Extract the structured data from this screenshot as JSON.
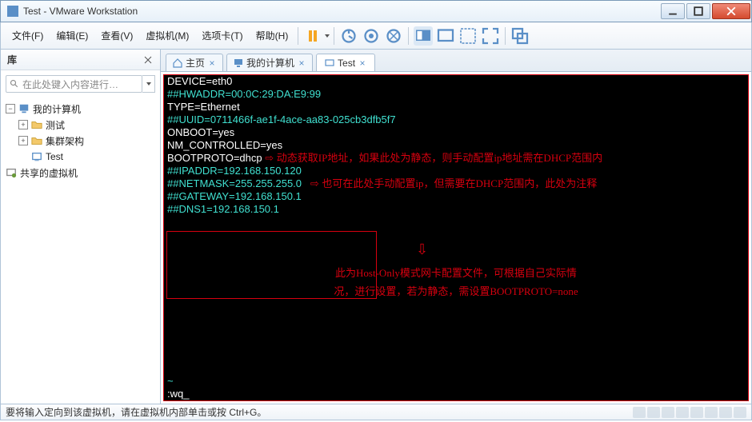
{
  "window": {
    "title": "Test - VMware Workstation"
  },
  "menu": {
    "file": "文件(F)",
    "edit": "编辑(E)",
    "view": "查看(V)",
    "vm": "虚拟机(M)",
    "tabs": "选项卡(T)",
    "help": "帮助(H)"
  },
  "sidebar": {
    "title": "库",
    "search_placeholder": "在此处键入内容进行…",
    "nodes": {
      "root": "我的计算机",
      "n1": "测试",
      "n2": "集群架构",
      "n3": "Test",
      "shared": "共享的虚拟机"
    }
  },
  "tabs": {
    "home": "主页",
    "mycomputer": "我的计算机",
    "test": "Test"
  },
  "console": {
    "l1": "DEVICE=eth0",
    "l2": "##HWADDR=00:0C:29:DA:E9:99",
    "l3": "TYPE=Ethernet",
    "l4": "##UUID=0711466f-ae1f-4ace-aa83-025cb3dfb5f7",
    "l5": "ONBOOT=yes",
    "l6": "NM_CONTROLLED=yes",
    "l7": "BOOTPROTO=dhcp",
    "l8": "##IPADDR=192.168.150.120",
    "l9": "##NETMASK=255.255.255.0",
    "l10": "##GATEWAY=192.168.150.1",
    "l11": "##DNS1=192.168.150.1",
    "wq": ":wq",
    "cursor": "_"
  },
  "annotations": {
    "a1": "动态获取IP地址，如果此处为静态，则手动配置ip地址需在DHCP范围内",
    "a2": "也可在此处手动配置ip，但需要在DHCP范围内，此处为注释",
    "a3_l1": "此为Host-Only模式网卡配置文件，可根据自己实际情",
    "a3_l2": "况，进行设置，若为静态，需设置BOOTPROTO=none"
  },
  "statusbar": {
    "text": "要将输入定向到该虚拟机，请在虚拟机内部单击或按 Ctrl+G。"
  }
}
